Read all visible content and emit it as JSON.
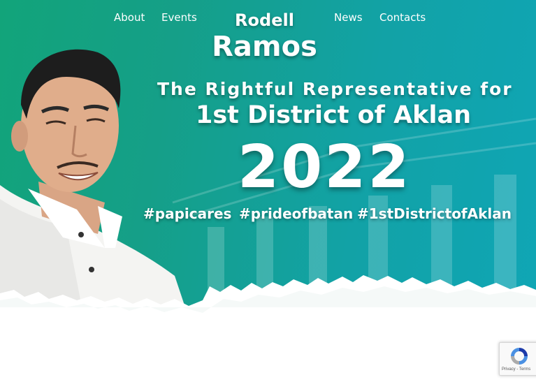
{
  "nav": {
    "about": "About",
    "events": "Events",
    "news": "News",
    "contacts": "Contacts"
  },
  "brand": {
    "first_name": "Rodell",
    "last_name": "Ramos"
  },
  "hero": {
    "tagline": "The Rightful Representative for",
    "district": "1st District of Aklan",
    "year": "2022",
    "hashtags": [
      "#papicares",
      "#prideofbatan",
      "#1stDistrictofAklan"
    ]
  },
  "recaptcha": {
    "links": "Privacy - Terms"
  },
  "colors": {
    "gradient_start": "#12a47a",
    "gradient_end": "#0fa6b6",
    "text": "#ffffff"
  }
}
